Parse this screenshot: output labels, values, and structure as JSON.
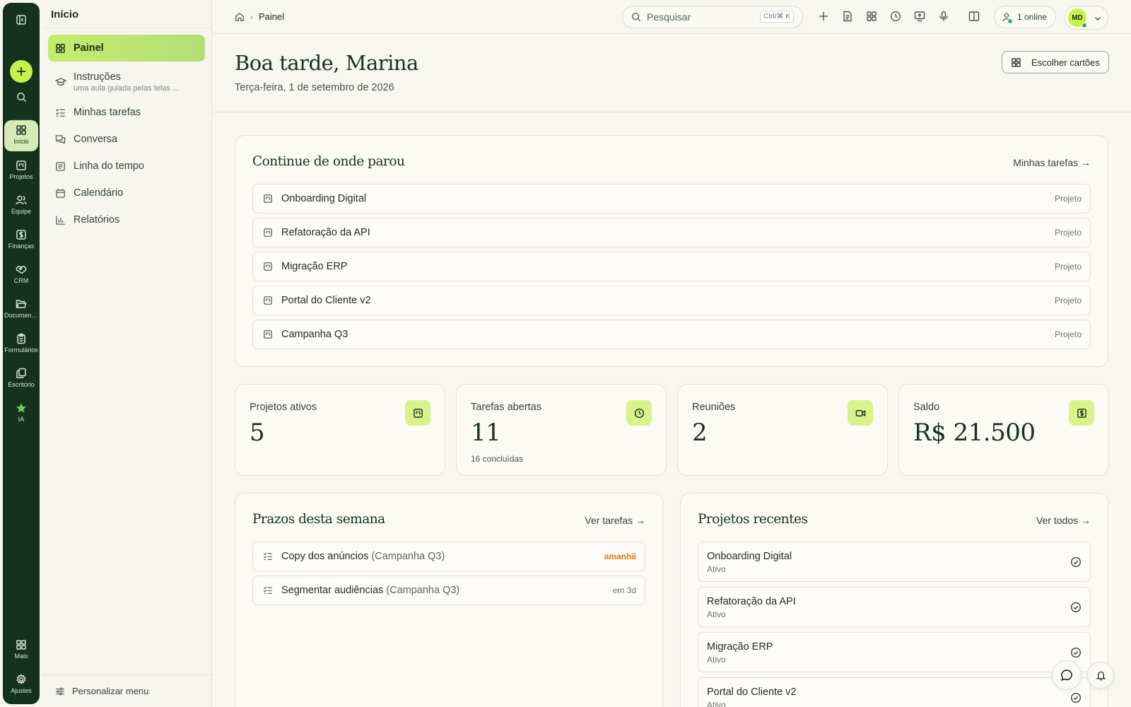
{
  "rail": {
    "items": [
      {
        "label": "Início",
        "icon": "grid-icon"
      },
      {
        "label": "Projetos",
        "icon": "kanban-icon"
      },
      {
        "label": "Equipe",
        "icon": "users-icon"
      },
      {
        "label": "Finanças",
        "icon": "dollar-icon"
      },
      {
        "label": "CRM",
        "icon": "handshake-icon"
      },
      {
        "label": "Documentos",
        "icon": "folder-icon"
      },
      {
        "label": "Formulários",
        "icon": "clipboard-icon"
      },
      {
        "label": "Escritório",
        "icon": "copy-icon"
      },
      {
        "label": "IA",
        "icon": "star-icon"
      }
    ],
    "more": "Mais",
    "settings": "Ajustes"
  },
  "sidebar": {
    "title": "Início",
    "items": [
      {
        "label": "Painel",
        "icon": "grid-icon"
      },
      {
        "label": "Instruções",
        "sub": "uma aula guiada pelas telas ...",
        "icon": "graduation-cap-icon"
      },
      {
        "label": "Minhas tarefas",
        "icon": "checklist-icon"
      },
      {
        "label": "Conversa",
        "icon": "chat-icon"
      },
      {
        "label": "Linha do tempo",
        "icon": "timeline-icon"
      },
      {
        "label": "Calendário",
        "icon": "calendar-icon"
      },
      {
        "label": "Relatórios",
        "icon": "bar-chart-icon"
      }
    ],
    "footer": "Personalizar menu"
  },
  "topbar": {
    "breadcrumb": "Painel",
    "search_placeholder": "Pesquisar",
    "shortcut": "Ctrl/⌘ K",
    "online": "1 online",
    "avatar_initials": "MD"
  },
  "header": {
    "greeting": "Boa tarde, Marina",
    "date": "Terça-feira, 1 de setembro de 2026",
    "choose_cards": "Escolher cartões"
  },
  "continue": {
    "title": "Continue de onde parou",
    "link": "Minhas tarefas →",
    "items": [
      {
        "name": "Onboarding Digital",
        "tag": "Projeto"
      },
      {
        "name": "Refatoração da API",
        "tag": "Projeto"
      },
      {
        "name": "Migração ERP",
        "tag": "Projeto"
      },
      {
        "name": "Portal do Cliente v2",
        "tag": "Projeto"
      },
      {
        "name": "Campanha Q3",
        "tag": "Projeto"
      }
    ]
  },
  "stats": [
    {
      "label": "Projetos ativos",
      "value": "5",
      "sub": "",
      "icon": "kanban-icon"
    },
    {
      "label": "Tarefas abertas",
      "value": "11",
      "sub": "16 concluídas",
      "icon": "clock-icon"
    },
    {
      "label": "Reuniões",
      "value": "2",
      "sub": "",
      "icon": "video-icon"
    },
    {
      "label": "Saldo",
      "value": "R$ 21.500",
      "sub": "",
      "icon": "dollar-icon"
    }
  ],
  "deadlines": {
    "title": "Prazos desta semana",
    "link": "Ver tarefas →",
    "items": [
      {
        "name": "Copy dos anúncios",
        "project": "(Campanha Q3)",
        "due": "amanhã",
        "due_color": "#e07a1a"
      },
      {
        "name": "Segmentar audiências",
        "project": "(Campanha Q3)",
        "due": "em 3d",
        "due_color": "#5b655f"
      }
    ]
  },
  "recent": {
    "title": "Projetos recentes",
    "link": "Ver todos →",
    "items": [
      {
        "name": "Onboarding Digital",
        "status": "Ativo"
      },
      {
        "name": "Refatoração da API",
        "status": "Ativo"
      },
      {
        "name": "Migração ERP",
        "status": "Ativo"
      },
      {
        "name": "Portal do Cliente v2",
        "status": "Ativo"
      }
    ]
  },
  "colors": {
    "accent": "#c8f04a",
    "rail": "#15321f",
    "warning": "#e07a1a"
  }
}
